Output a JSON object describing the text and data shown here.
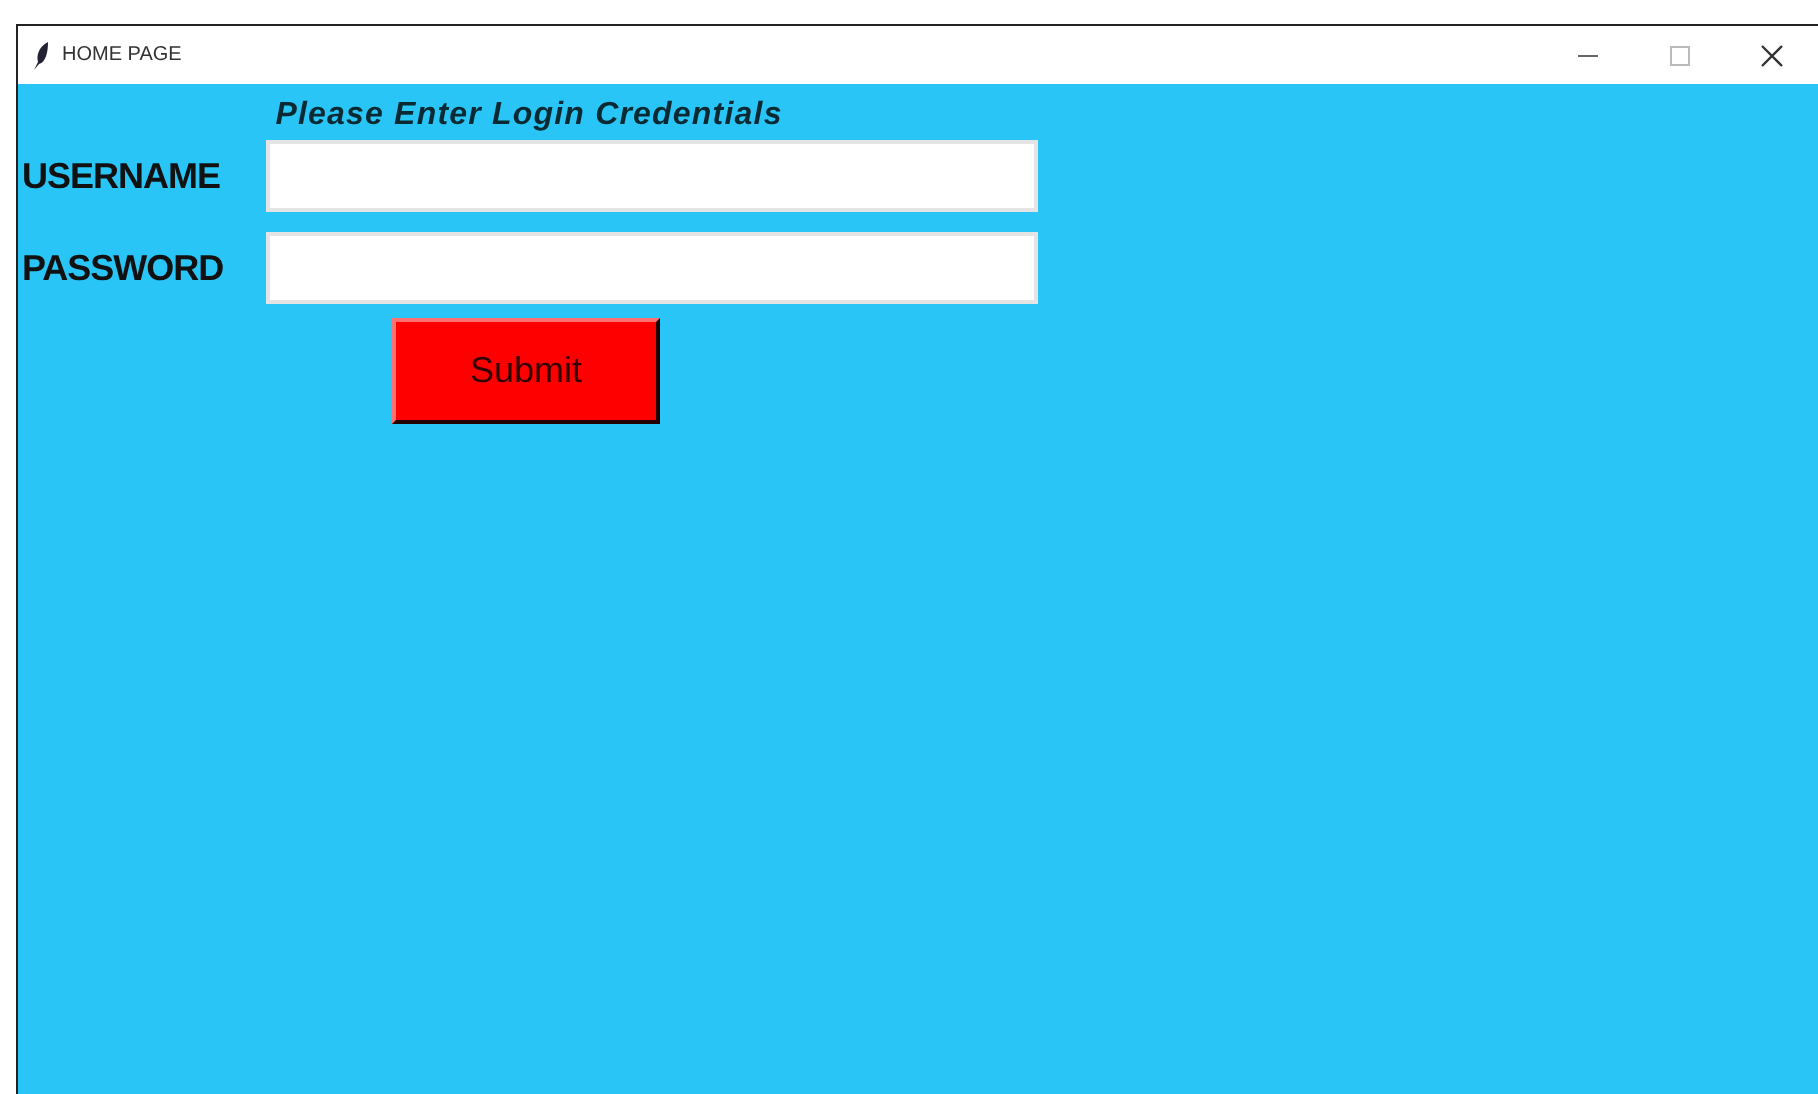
{
  "window": {
    "title": "HOME PAGE"
  },
  "heading": "Please Enter Login Credentials",
  "fields": [
    {
      "label": "USERNAME"
    },
    {
      "label": "PASSWORD"
    }
  ],
  "submit": "Submit"
}
